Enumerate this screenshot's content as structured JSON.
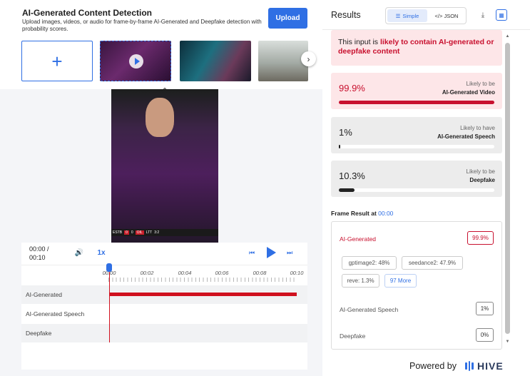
{
  "header": {
    "title": "AI-Generated Content Detection",
    "subtitle": "Upload images, videos, or audio for frame-by-frame AI-Generated and Deepfake detection with probability scores.",
    "upload_label": "Upload",
    "add_label": "+"
  },
  "player": {
    "time_current": "00:00 /",
    "time_total": "00:10",
    "speed": "1x",
    "hud": [
      "ESTB",
      "0",
      "0",
      "OIL",
      "LTT",
      "3:2"
    ]
  },
  "timeline": {
    "ticks": [
      "00:00",
      "00:02",
      "00:04",
      "00:06",
      "00:08",
      "00:10"
    ],
    "rows": [
      "AI-Generated",
      "AI-Generated Speech",
      "Deepfake"
    ]
  },
  "results": {
    "title": "Results",
    "toggle_simple": "Simple",
    "toggle_json": "</> JSON",
    "verdict_prefix": "This input is ",
    "verdict_highlight": "likely to contain AI-generated or deepfake content",
    "scores": [
      {
        "pct": "99.9%",
        "line1": "Likely to be",
        "line2": "AI-Generated Video",
        "value": 0.999
      },
      {
        "pct": "1%",
        "line1": "Likely to have",
        "line2": "AI-Generated Speech",
        "value": 0.01
      },
      {
        "pct": "10.3%",
        "line1": "Likely to be",
        "line2": "Deepfake",
        "value": 0.103
      }
    ],
    "frame_title": "Frame Result at ",
    "frame_time": "00:00",
    "frame": {
      "ai_label": "AI-Generated",
      "ai_value": "99.9%",
      "chips": [
        "gptimage2: 48%",
        "seedance2: 47.9%",
        "reve: 1.3%",
        "97 More"
      ],
      "speech_label": "AI-Generated Speech",
      "speech_value": "1%",
      "deepfake_label": "Deepfake",
      "deepfake_value": "0%"
    }
  },
  "footer": {
    "powered": "Powered by",
    "brand": "HIVE"
  },
  "colors": {
    "accent": "#2f6fe4",
    "danger": "#c8102e"
  }
}
